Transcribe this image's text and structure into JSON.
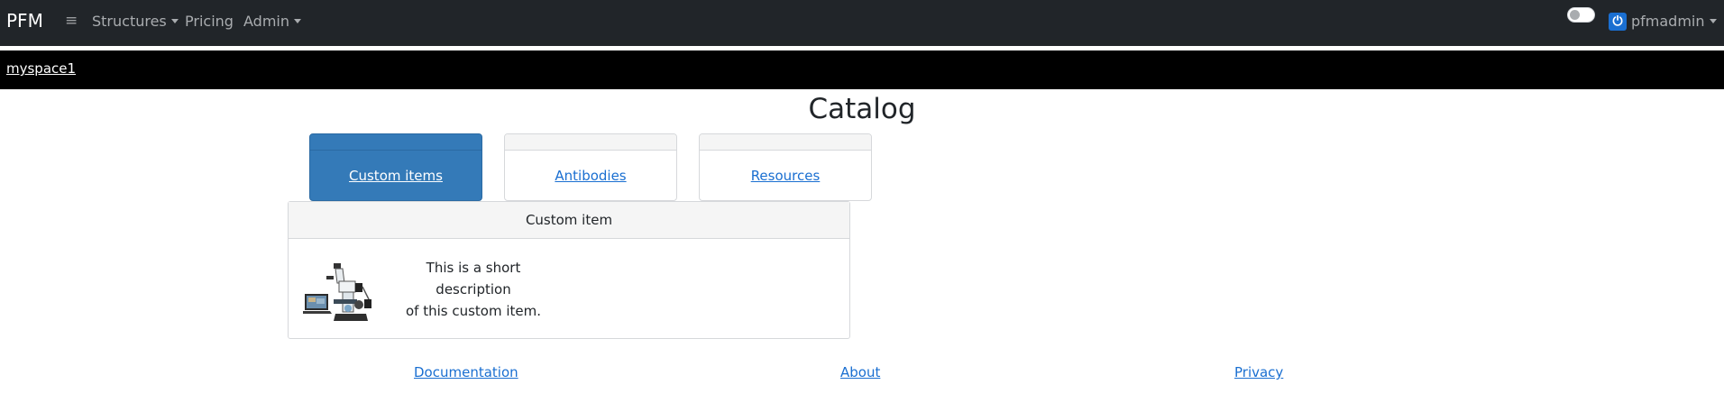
{
  "navbar": {
    "brand": "PFM",
    "items": [
      {
        "label": "Structures"
      },
      {
        "label": "Pricing"
      },
      {
        "label": "Admin"
      }
    ],
    "user": "pfmadmin",
    "theme_toggle_on": false
  },
  "space": {
    "name": "myspace1"
  },
  "page": {
    "title": "Catalog"
  },
  "categories": [
    {
      "label": "Custom items",
      "active": true
    },
    {
      "label": "Antibodies",
      "active": false
    },
    {
      "label": "Resources",
      "active": false
    }
  ],
  "item": {
    "title": "Custom item",
    "description_line1": "This is a short description",
    "description_line2": "of this custom item."
  },
  "footer": {
    "documentation": "Documentation",
    "about": "About",
    "privacy": "Privacy"
  },
  "colors": {
    "navbar": "#212529",
    "spacebar": "#000000",
    "active_tab": "#347ab8",
    "link": "#1a6fd1"
  }
}
